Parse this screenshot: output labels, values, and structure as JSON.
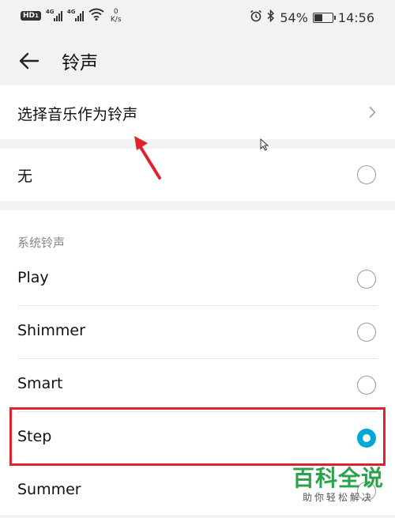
{
  "status_bar": {
    "hd_badge": "HD",
    "sim_indicator": "1",
    "network_1": "4G",
    "network_2": "4G",
    "speed_value": "0",
    "speed_unit": "K/s",
    "battery_percent": "54%",
    "battery_level": 0.54,
    "time": "14:56",
    "icons": [
      "alarm-icon",
      "bluetooth-icon",
      "wifi-icon",
      "battery-icon"
    ]
  },
  "header": {
    "title": "铃声"
  },
  "choose_music": {
    "label": "选择音乐作为铃声"
  },
  "none_option": {
    "label": "无",
    "selected": false
  },
  "system_ringtones": {
    "group_title": "系统铃声",
    "items": [
      {
        "label": "Play",
        "selected": false
      },
      {
        "label": "Shimmer",
        "selected": false
      },
      {
        "label": "Smart",
        "selected": false
      },
      {
        "label": "Step",
        "selected": true
      },
      {
        "label": "Summer",
        "selected": false
      }
    ]
  },
  "watermark": {
    "title": "百科全说",
    "subtitle": "助你轻松解决"
  },
  "colors": {
    "accent": "#00a7d8",
    "annotation": "#e0222c",
    "watermark": "#2aa34a",
    "background": "#f2f2f2"
  }
}
